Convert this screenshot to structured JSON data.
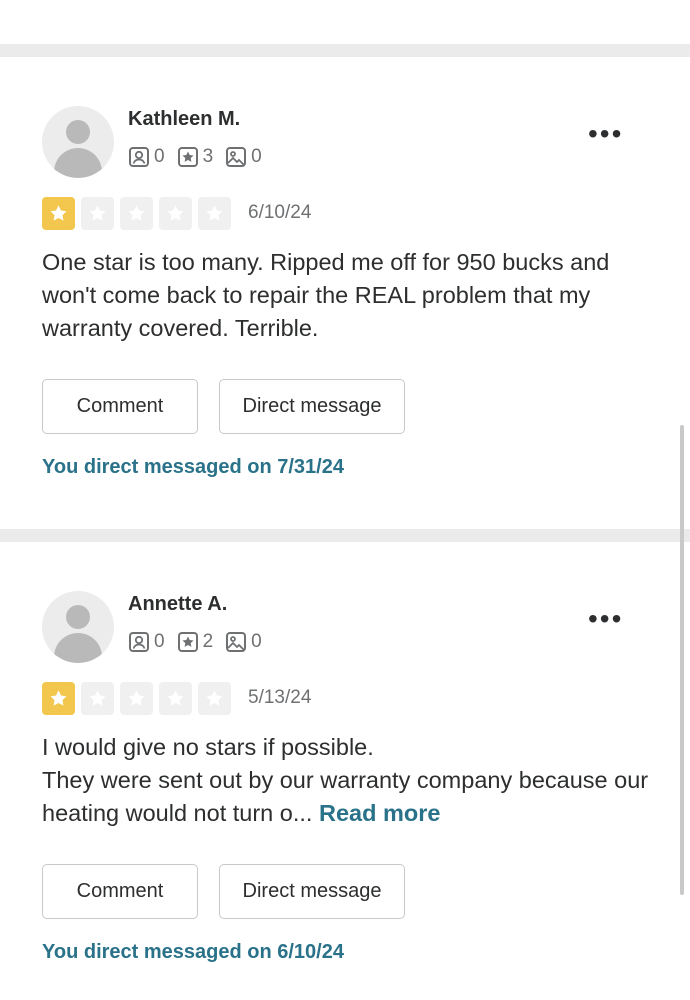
{
  "colors": {
    "accent_teal": "#2a7289",
    "star_on": "#f3c74d",
    "star_off": "#f0f0f0",
    "divider": "#ebebeb"
  },
  "reviews": [
    {
      "name": "Kathleen M.",
      "stats": {
        "friends": "0",
        "reviews": "3",
        "photos": "0"
      },
      "rating": 1,
      "date": "6/10/24",
      "text": "One star is too many. Ripped me off for 950 bucks and won't come back to repair the REAL problem that my warranty covered. Terrible.",
      "read_more": "",
      "comment_label": "Comment",
      "dm_label": "Direct message",
      "dm_note": "You direct messaged on 7/31/24",
      "more_icon": "ellipsis-icon"
    },
    {
      "name": "Annette A.",
      "stats": {
        "friends": "0",
        "reviews": "2",
        "photos": "0"
      },
      "rating": 1,
      "date": "5/13/24",
      "text_line1": "I would give no stars if possible.",
      "text_line2": "They were sent out by our warranty company because our heating would not turn o...",
      "read_more": "Read more",
      "comment_label": "Comment",
      "dm_label": "Direct message",
      "dm_note": "You direct messaged on 6/10/24",
      "more_icon": "ellipsis-icon"
    }
  ]
}
